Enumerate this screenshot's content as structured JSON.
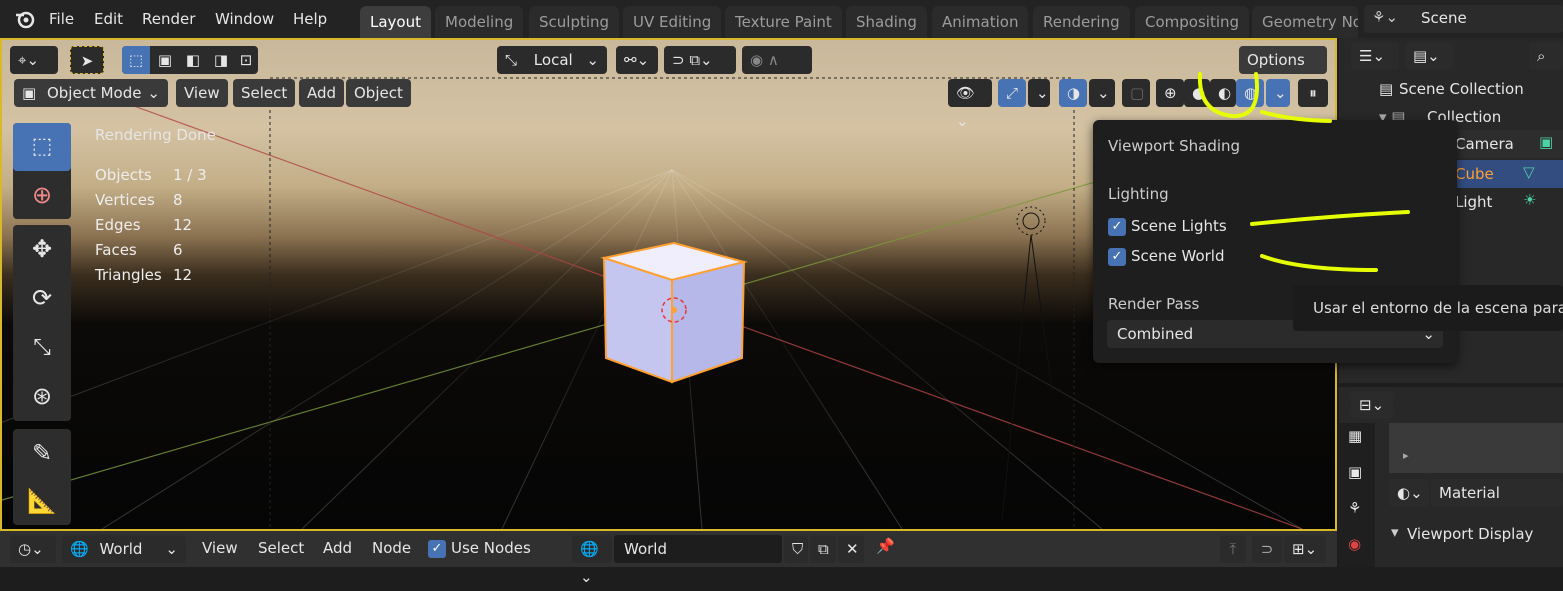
{
  "topbar": {
    "menus": [
      "File",
      "Edit",
      "Render",
      "Window",
      "Help"
    ],
    "tabs": [
      "Layout",
      "Modeling",
      "Sculpting",
      "UV Editing",
      "Texture Paint",
      "Shading",
      "Animation",
      "Rendering",
      "Compositing",
      "Geometry No"
    ],
    "scene_label": "Scene"
  },
  "viewport_header": {
    "orientation": "Local",
    "options_label": "Options",
    "mode": "Object Mode",
    "menus": [
      "View",
      "Select",
      "Add",
      "Object"
    ]
  },
  "stats": {
    "status": "Rendering Done",
    "rows": [
      {
        "label": "Objects",
        "value": "1 / 3"
      },
      {
        "label": "Vertices",
        "value": "8"
      },
      {
        "label": "Edges",
        "value": "12"
      },
      {
        "label": "Faces",
        "value": "6"
      },
      {
        "label": "Triangles",
        "value": "12"
      }
    ]
  },
  "popover": {
    "title": "Viewport Shading",
    "lighting_label": "Lighting",
    "scene_lights": "Scene Lights",
    "scene_world": "Scene World",
    "render_pass_label": "Render Pass",
    "render_pass_value": "Combined"
  },
  "tooltip": {
    "text": "Usar el entorno de la escena para i"
  },
  "outliner": {
    "root": "Scene Collection",
    "collection": "Collection",
    "items": [
      "Camera",
      "Cube",
      "Light"
    ]
  },
  "properties": {
    "material_label": "Material",
    "viewport_display": "Viewport Display"
  },
  "bottombar": {
    "editor_type": "World",
    "menus": [
      "View",
      "Select",
      "Add",
      "Node"
    ],
    "use_nodes": "Use Nodes",
    "world_name": "World"
  },
  "colors": {
    "accent": "#4772b3",
    "highlight": "#e6ff00",
    "selected": "#ffa033",
    "border": "#d8b928"
  }
}
